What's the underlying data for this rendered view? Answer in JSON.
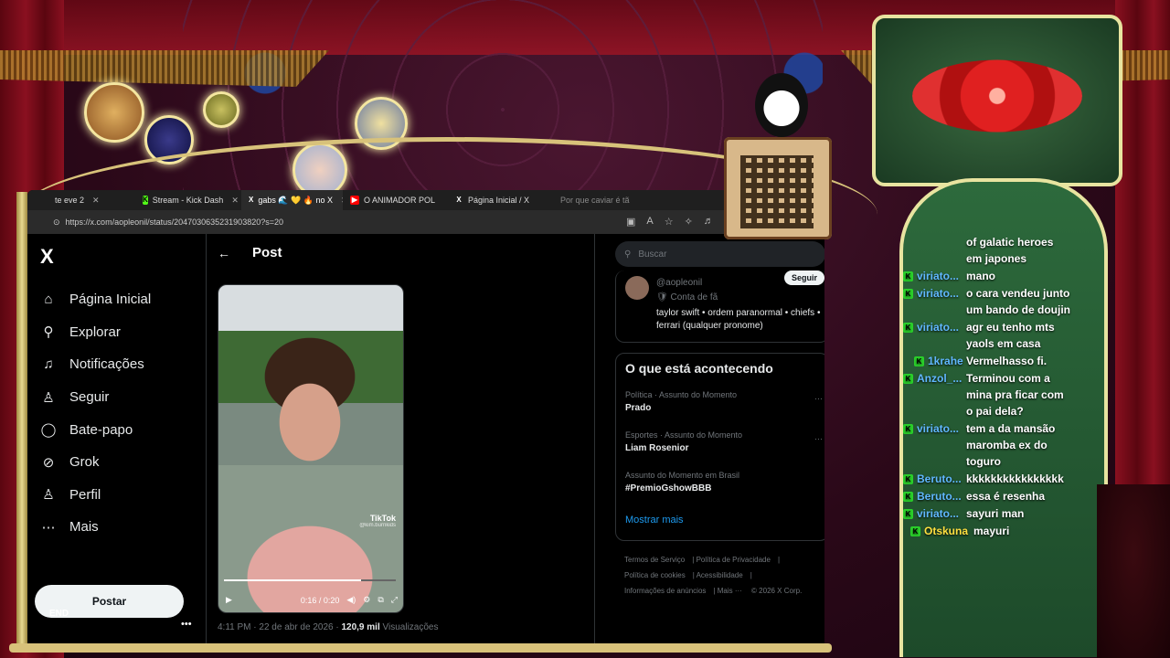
{
  "browser": {
    "tabs": [
      {
        "label": "te eve 2",
        "icon": "avatar"
      },
      {
        "label": "Stream - Kick Dash",
        "icon": "kick"
      },
      {
        "label": "gabs 🌊 💛 🔥 no X",
        "icon": "x",
        "active": true
      },
      {
        "label": "O ANIMADOR POL",
        "icon": "youtube"
      },
      {
        "label": "Página Inicial / X",
        "icon": "x"
      },
      {
        "label": "Por que caviar é tã",
        "icon": "search"
      }
    ],
    "url": "https://x.com/aopleonil/status/2047030635231903820?s=20"
  },
  "x_sidebar": {
    "logo": "X",
    "nav": [
      {
        "label": "Página Inicial",
        "icon": "home-icon",
        "glyph": "⌂"
      },
      {
        "label": "Explorar",
        "icon": "search-icon",
        "glyph": "⚲"
      },
      {
        "label": "Notificações",
        "icon": "bell-icon",
        "glyph": "♫"
      },
      {
        "label": "Seguir",
        "icon": "follow-icon",
        "glyph": "♙"
      },
      {
        "label": "Bate-papo",
        "icon": "chat-icon",
        "glyph": "◯"
      },
      {
        "label": "Grok",
        "icon": "grok-icon",
        "glyph": "⊘"
      },
      {
        "label": "Perfil",
        "icon": "profile-icon",
        "glyph": "♙"
      },
      {
        "label": "Mais",
        "icon": "more-icon",
        "glyph": "⋯"
      }
    ],
    "post_button": "Postar",
    "account_name": "END",
    "account_more": "•••"
  },
  "post": {
    "back": "←",
    "title": "Post",
    "watermark": "TikTok",
    "watermark_handle": "@kim.burnkids",
    "video_time": "0:16 / 0:20",
    "progress": 0.8,
    "time": "4:11 PM",
    "date": "22 de abr de 2026",
    "views": "120,9 mil",
    "views_label": "Visualizações"
  },
  "right": {
    "search_placeholder": "Buscar",
    "user": {
      "handle": "@aopleonil",
      "fan": "Conta de fã",
      "bio": "taylor swift • ordem paranormal • chiefs • ferrari (qualquer pronome)",
      "follow": "Seguir"
    },
    "trends_title": "O que está acontecendo",
    "trends": [
      {
        "meta": "Política · Assunto do Momento",
        "name": "Prado"
      },
      {
        "meta": "Esportes · Assunto do Momento",
        "name": "Liam Rosenior"
      },
      {
        "meta": "Assunto do Momento em Brasil",
        "name": "#PremioGshowBBB"
      }
    ],
    "show_more": "Mostrar mais",
    "footer": [
      "Termos de Serviço",
      "Política de Privacidade",
      "Política de cookies",
      "Acessibilidade",
      "Informações de anúncios",
      "Mais ···",
      "© 2026 X Corp."
    ]
  },
  "chat": {
    "messages": [
      {
        "user": "",
        "text": "of galatic heroes em japones"
      },
      {
        "user": "viriato...",
        "text": "mano"
      },
      {
        "user": "viriato...",
        "text": "o cara vendeu junto um bando de doujin"
      },
      {
        "user": "viriato...",
        "text": "agr eu tenho mts yaols em casa"
      },
      {
        "user": "1krahe",
        "text": "Vermelhasso fi."
      },
      {
        "user": "Anzol_...",
        "text": "Terminou com a mina pra ficar com o pai dela?"
      },
      {
        "user": "viriato...",
        "text": "tem a da mansão maromba ex do toguro"
      },
      {
        "user": "Beruto...",
        "text": "kkkkkkkkkkkkkkkk"
      },
      {
        "user": "Beruto...",
        "text": "essa é resenha"
      },
      {
        "user": "viriato...",
        "text": "sayuri man"
      },
      {
        "user": "Otskuna",
        "text": "mayuri",
        "yellow": true
      }
    ]
  },
  "colors": {
    "x_blue": "#1d9bf0",
    "kick_green": "#2ad02a",
    "frame_gold": "#d8c27a"
  }
}
